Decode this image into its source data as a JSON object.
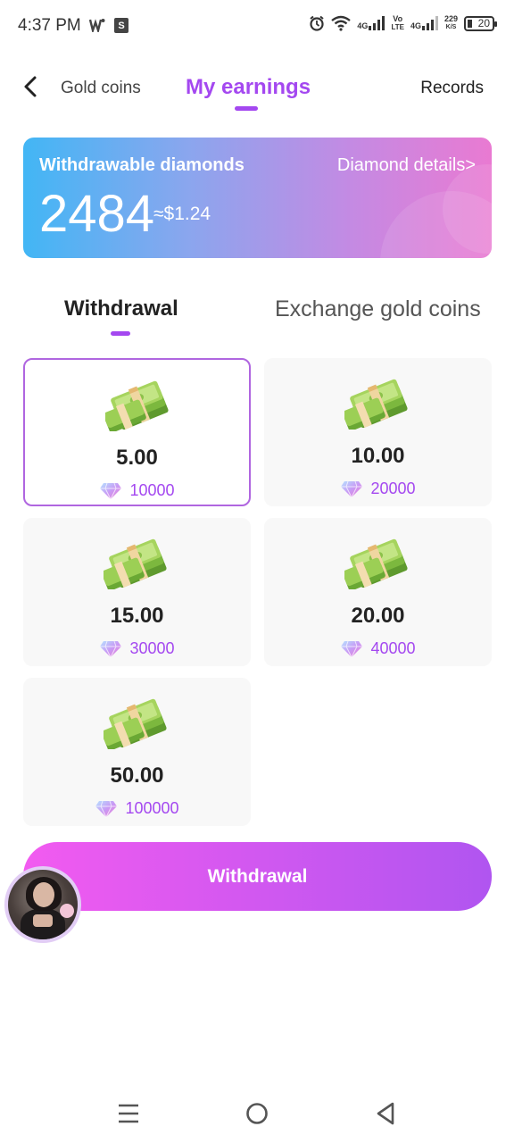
{
  "status_bar": {
    "time": "4:37 PM",
    "net_type_1": "4G",
    "volte_top": "Vo",
    "volte_bottom": "LTE",
    "net_type_2": "4G",
    "speed_value": "229",
    "speed_unit": "K/S",
    "battery": "20"
  },
  "header": {
    "tab_gold": "Gold coins",
    "tab_earnings": "My earnings",
    "records": "Records"
  },
  "diamond_card": {
    "title": "Withdrawable diamonds",
    "details_link": "Diamond details>",
    "amount": "2484",
    "usd_equivalent": "≈$1.24"
  },
  "section_tabs": {
    "withdrawal": "Withdrawal",
    "exchange": "Exchange gold coins"
  },
  "options": [
    {
      "amount": "5.00",
      "diamonds": "10000",
      "selected": true
    },
    {
      "amount": "10.00",
      "diamonds": "20000",
      "selected": false
    },
    {
      "amount": "15.00",
      "diamonds": "30000",
      "selected": false
    },
    {
      "amount": "20.00",
      "diamonds": "40000",
      "selected": false
    },
    {
      "amount": "50.00",
      "diamonds": "100000",
      "selected": false
    }
  ],
  "withdraw_button": "Withdrawal",
  "colors": {
    "accent": "#a448f0",
    "button_start": "#f25bf0",
    "button_end": "#b055f0",
    "card_start": "#42b6f5",
    "card_end": "#e97ad2",
    "selected_border": "#b066e0"
  },
  "icons": {
    "back": "chevron-left-icon",
    "money": "cash-stack-icon",
    "diamond": "diamond-icon",
    "nav_menu": "menu-icon",
    "nav_home": "home-circle-icon",
    "nav_back": "triangle-back-icon"
  }
}
